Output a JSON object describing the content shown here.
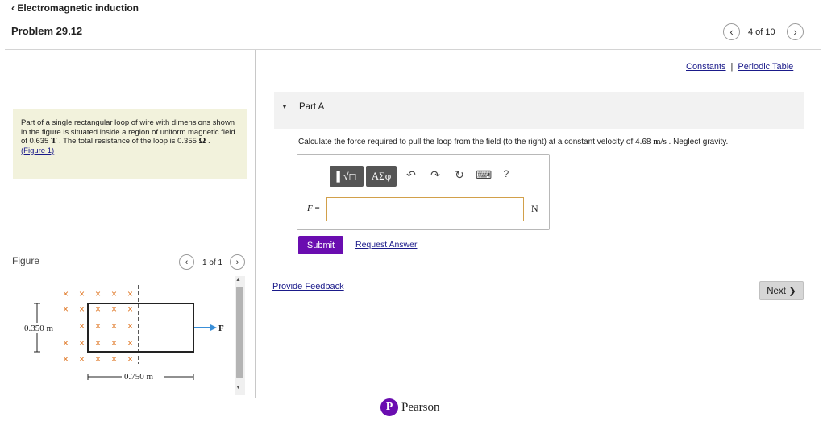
{
  "header": {
    "back_label": "‹ Electromagnetic induction",
    "problem_title": "Problem 29.12",
    "prev_icon": "chevron-left-icon",
    "next_icon": "chevron-right-icon",
    "page_counter": "4 of 10"
  },
  "links": {
    "constants": "Constants",
    "separator": "|",
    "periodic_table": "Periodic Table"
  },
  "problem": {
    "text_1": "Part of a single rectangular loop of wire with dimensions shown in the figure is situated inside a region of uniform magnetic field of 0.635 ",
    "field_unit": "T",
    "text_2": " . The total resistance of the loop is 0.355 ",
    "resistance_unit": "Ω",
    "text_3": " .",
    "figure_link": "(Figure 1)"
  },
  "figure_panel": {
    "label": "Figure",
    "counter": "1 of 1",
    "height_label": "0.350 m",
    "width_label": "0.750 m",
    "force_label": "F⃗",
    "cross_glyph": "×"
  },
  "part": {
    "title": "Part A",
    "question_1": "Calculate the force required to pull the loop from the field (to the right) at a constant velocity of 4.68 ",
    "velocity_unit": "m/s",
    "question_2": " . Neglect gravity."
  },
  "toolbar": {
    "templates_label": "▌√◻",
    "greek_label": "ΑΣφ",
    "undo_glyph": "↶",
    "redo_glyph": "↷",
    "reset_glyph": "↻",
    "keyboard_glyph": "⌨",
    "help_glyph": "?"
  },
  "answer": {
    "variable": "F",
    "equals": " =",
    "value": "",
    "unit": "N"
  },
  "actions": {
    "submit": "Submit",
    "request_answer": "Request Answer",
    "provide_feedback": "Provide Feedback",
    "next": "Next ❯"
  },
  "footer": {
    "logo_letter": "P",
    "brand": "Pearson"
  },
  "colors": {
    "submit_bg": "#6a0db0",
    "problem_box_bg": "#f2f2dc",
    "cross_color": "#e07a2a",
    "force_arrow": "#3a8fd8"
  }
}
